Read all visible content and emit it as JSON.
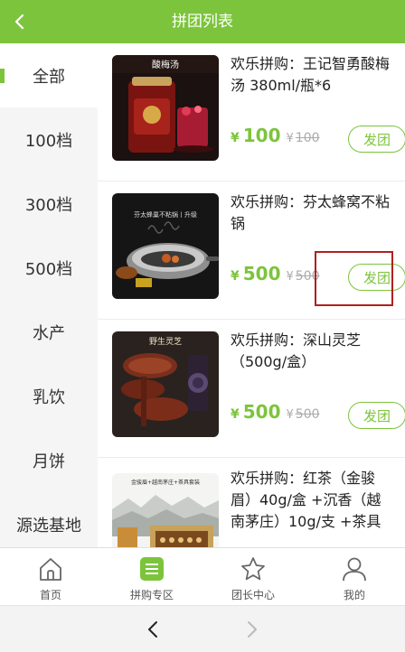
{
  "header": {
    "title": "拼团列表"
  },
  "sidebar": {
    "categories": [
      {
        "label": "全部",
        "active": true
      },
      {
        "label": "100档"
      },
      {
        "label": "300档"
      },
      {
        "label": "500档"
      },
      {
        "label": "水产"
      },
      {
        "label": "乳饮"
      },
      {
        "label": "月饼"
      },
      {
        "label": "源选基地"
      }
    ]
  },
  "products": [
    {
      "name": "欢乐拼购：王记智勇酸梅汤 380ml/瓶*6",
      "currency": "¥",
      "price": "100",
      "original_price": "100",
      "button": "发团",
      "image_caption": "酸梅汤"
    },
    {
      "name": "欢乐拼购：芬太蜂窝不粘锅",
      "currency": "¥",
      "price": "500",
      "original_price": "500",
      "button": "发团",
      "image_caption": "芬太蜂巢不粘锅丨升级"
    },
    {
      "name": "欢乐拼购：深山灵芝（500g/盒）",
      "currency": "¥",
      "price": "500",
      "original_price": "500",
      "button": "发团",
      "image_caption": "野生灵芝"
    },
    {
      "name": "欢乐拼购：红茶（金骏眉）40g/盒 +沉香（越南茅庄）10g/支 +茶具",
      "currency": "¥",
      "price": "",
      "original_price": "",
      "button": "",
      "image_caption": "金骏眉+越南茅庄+茶具套装"
    }
  ],
  "tabbar": {
    "tabs": [
      {
        "label": "首页",
        "icon": "home-icon"
      },
      {
        "label": "拼购专区",
        "icon": "list-icon",
        "active": true
      },
      {
        "label": "团长中心",
        "icon": "star-icon"
      },
      {
        "label": "我的",
        "icon": "user-icon"
      }
    ]
  },
  "colors": {
    "accent": "#7cc43c",
    "highlight_box": "#b0201e",
    "sidebar_bg": "#f5f5f5"
  }
}
